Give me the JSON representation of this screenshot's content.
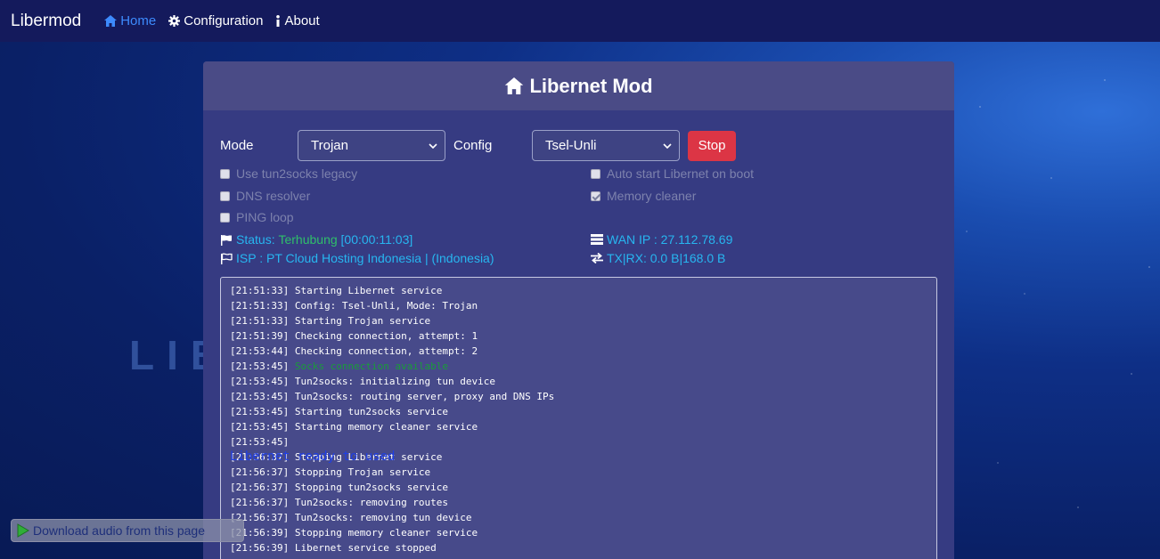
{
  "navbar": {
    "brand": "Libermod",
    "links": [
      {
        "label": "Home",
        "icon": "home-icon",
        "active": true
      },
      {
        "label": "Configuration",
        "icon": "gear-icon",
        "active": false
      },
      {
        "label": "About",
        "icon": "info-icon",
        "active": false
      }
    ]
  },
  "background": {
    "text": "LIB"
  },
  "card": {
    "title": "Libernet Mod",
    "mode_label": "Mode",
    "mode_value": "Trojan",
    "config_label": "Config",
    "config_value": "Tsel-Unli",
    "stop_label": "Stop",
    "options": {
      "tun2socks_legacy": {
        "label": "Use tun2socks legacy",
        "checked": false
      },
      "dns_resolver": {
        "label": "DNS resolver",
        "checked": false
      },
      "ping_loop": {
        "label": "PING loop",
        "checked": false
      },
      "auto_start": {
        "label": "Auto start Libernet on boot",
        "checked": false
      },
      "memory_cleaner": {
        "label": "Memory cleaner",
        "checked": true
      }
    },
    "status": {
      "label": "Status:",
      "state": "Terhubung",
      "uptime": "[00:00:11:03]"
    },
    "isp": "ISP : PT Cloud Hosting Indonesia | (Indonesia)",
    "wan_ip": "WAN IP : 27.112.78.69",
    "txrx": "TX|RX: 0.0 B|168.0 B"
  },
  "log": [
    {
      "time": "[21:51:33]",
      "msg": "Starting Libernet service",
      "type": "normal"
    },
    {
      "time": "[21:51:33]",
      "msg": "Config: Tsel-Unli, Mode: Trojan",
      "type": "normal"
    },
    {
      "time": "[21:51:33]",
      "msg": "Starting Trojan service",
      "type": "normal"
    },
    {
      "time": "[21:51:39]",
      "msg": "Checking connection, attempt: 1",
      "type": "normal"
    },
    {
      "time": "[21:53:44]",
      "msg": "Checking connection, attempt: 2",
      "type": "normal"
    },
    {
      "time": "[21:53:45]",
      "msg": "Socks connection available",
      "type": "ok"
    },
    {
      "time": "[21:53:45]",
      "msg": "Tun2socks: initializing tun device",
      "type": "normal"
    },
    {
      "time": "[21:53:45]",
      "msg": "Tun2socks: routing server, proxy and DNS IPs",
      "type": "normal"
    },
    {
      "time": "[21:53:45]",
      "msg": "Starting tun2socks service",
      "type": "normal"
    },
    {
      "time": "[21:53:45]",
      "msg": "Starting memory cleaner service",
      "type": "normal"
    },
    {
      "time": "[21:53:45]",
      "msg": "Libernet ready to used",
      "type": "info"
    },
    {
      "time": "[21:56:37]",
      "msg": "Stopping Libernet service",
      "type": "normal"
    },
    {
      "time": "[21:56:37]",
      "msg": "Stopping Trojan service",
      "type": "normal"
    },
    {
      "time": "[21:56:37]",
      "msg": "Stopping tun2socks service",
      "type": "normal"
    },
    {
      "time": "[21:56:37]",
      "msg": "Tun2socks: removing routes",
      "type": "normal"
    },
    {
      "time": "[21:56:37]",
      "msg": "Tun2socks: removing tun device",
      "type": "normal"
    },
    {
      "time": "[21:56:39]",
      "msg": "Stopping memory cleaner service",
      "type": "normal"
    },
    {
      "time": "[21:56:39]",
      "msg": "Libernet service stopped",
      "type": "normal"
    }
  ],
  "overlay": {
    "download_audio": "Download audio from this page"
  }
}
